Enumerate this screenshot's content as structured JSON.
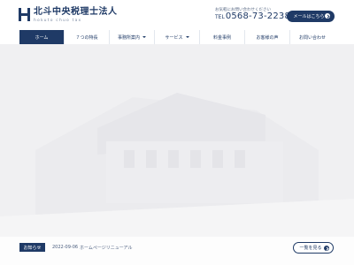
{
  "header": {
    "logo_name": "北斗中央税理士法人",
    "logo_sub": "hokuto chuo tax",
    "tel_note": "お気軽にお問い合わせください",
    "tel_label": "TEL",
    "tel_number": "0568-73-2238",
    "mail_button": "メールはこちら"
  },
  "nav": {
    "items": [
      {
        "label": "ホーム",
        "active": true
      },
      {
        "label": "７つの特長"
      },
      {
        "label": "事務所案内"
      },
      {
        "label": "サービス"
      },
      {
        "label": "料金事例"
      },
      {
        "label": "お客様の声"
      },
      {
        "label": "お問い合わせ"
      }
    ]
  },
  "news": {
    "badge": "お知らせ",
    "date": "2022-09-06",
    "title": "ホームページリニューアル",
    "list_button": "一覧を見る"
  },
  "colors": {
    "brand": "#1f3a66",
    "hero_bg": "#f1f1f3"
  }
}
